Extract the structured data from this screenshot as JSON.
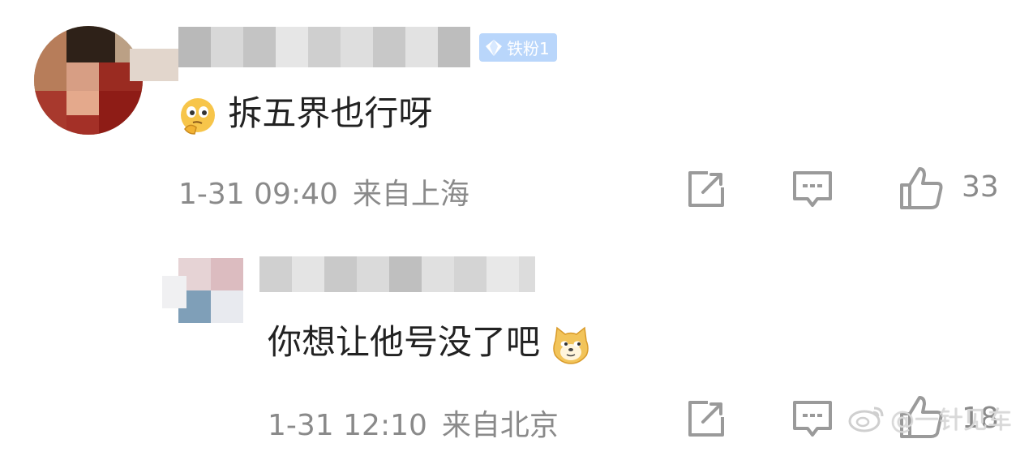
{
  "comment": {
    "badge_label": "铁粉1",
    "text": "拆五界也行呀",
    "emoji": "thinking-face-emoji",
    "time": "1-31 09:40",
    "location": "来自上海",
    "likes": "33"
  },
  "reply": {
    "text": "你想让他号没了吧",
    "emoji": "doge-emoji",
    "time": "1-31 12:10",
    "location": "来自北京",
    "likes": "18"
  },
  "icons": {
    "share": "share-icon",
    "comment": "comment-icon",
    "like": "thumbs-up-icon"
  },
  "watermark": {
    "text": "@一针见车"
  },
  "colors": {
    "text_primary": "#222222",
    "text_secondary": "#8a8a8a",
    "badge_bg": "#b9d6fb",
    "icon_gray": "#9a9a9a"
  }
}
